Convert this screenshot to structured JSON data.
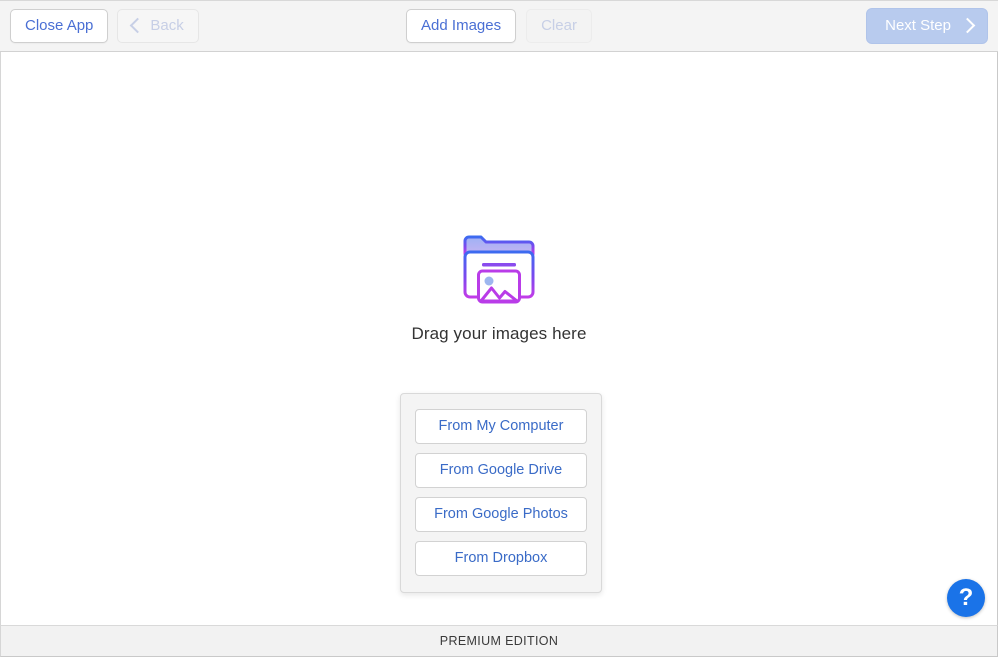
{
  "toolbar": {
    "close_app_label": "Close App",
    "back_label": "Back",
    "back_icon": "chevron-left-icon",
    "add_images_label": "Add Images",
    "clear_label": "Clear",
    "next_step_label": "Next Step",
    "next_step_icon": "chevron-right-icon"
  },
  "canvas": {
    "folder_icon": "folder-with-photo-icon",
    "drop_text": "Drag your images here"
  },
  "source_popup": {
    "buttons": [
      {
        "label": "From My Computer",
        "name": "source-my-computer"
      },
      {
        "label": "From Google Drive",
        "name": "source-google-drive"
      },
      {
        "label": "From Google Photos",
        "name": "source-google-photos"
      },
      {
        "label": "From Dropbox",
        "name": "source-dropbox"
      }
    ]
  },
  "help": {
    "icon": "question-mark-icon",
    "label": "?"
  },
  "footer": {
    "edition_label": "PREMIUM EDITION"
  },
  "colors": {
    "accent_blue": "#4a6fd4",
    "link_blue": "#3a6bc7",
    "next_step_bg": "#b8cbee",
    "help_blue": "#1a73e8",
    "toolbar_bg": "#f4f4f4",
    "popup_bg": "#f4f4f4",
    "icon_gradient_start": "#3c6bf0",
    "icon_gradient_end": "#c13ce8"
  }
}
